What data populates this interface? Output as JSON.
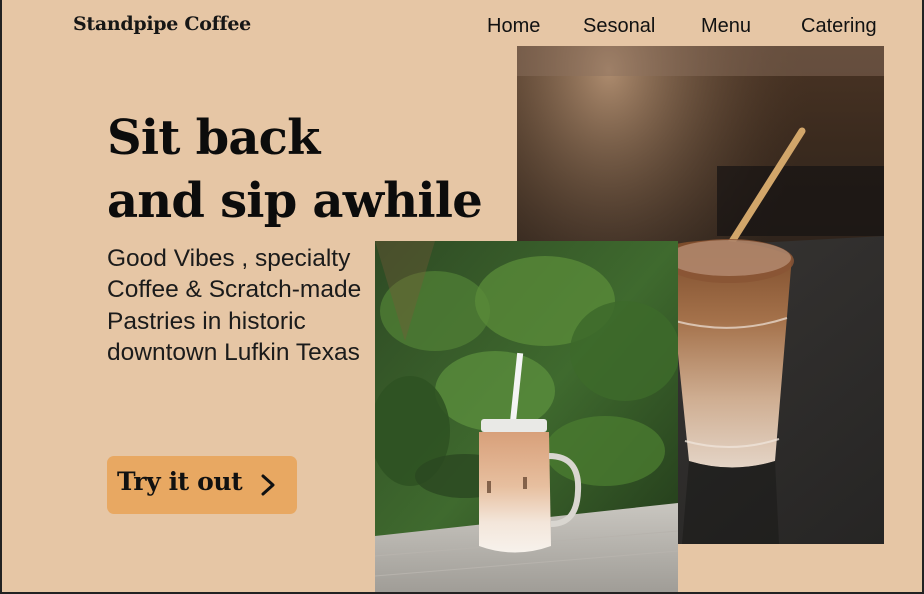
{
  "header": {
    "logo": "Standpipe Coffee",
    "nav": [
      {
        "label": "Home"
      },
      {
        "label": "Sesonal"
      },
      {
        "label": "Menu"
      },
      {
        "label": "Catering"
      }
    ]
  },
  "hero": {
    "title_line1": "Sit back",
    "title_line2": "and sip awhile",
    "subtitle": "Good Vibes , specialty Coffee & Scratch-made Pastries in historic downtown Lufkin Texas",
    "cta_label": "Try it out",
    "cta_icon": "chevron-right-icon"
  },
  "colors": {
    "background": "#e6c6a5",
    "cta": "#e8a862",
    "text": "#111111"
  }
}
